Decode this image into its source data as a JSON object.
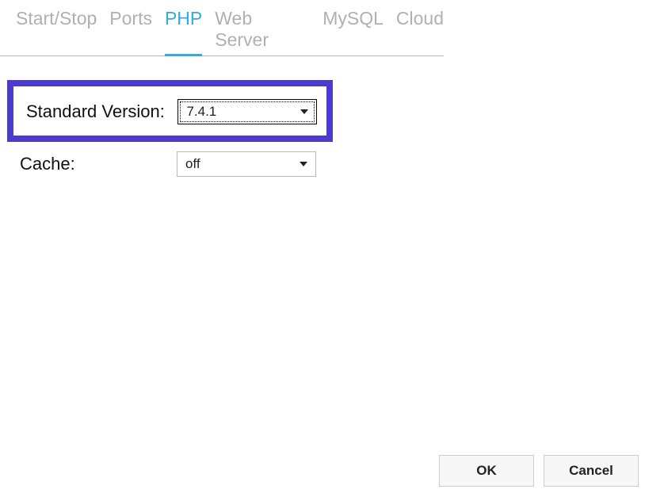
{
  "tabs": {
    "items": [
      {
        "label": "Start/Stop"
      },
      {
        "label": "Ports"
      },
      {
        "label": "PHP"
      },
      {
        "label": "Web Server"
      },
      {
        "label": "MySQL"
      },
      {
        "label": "Cloud"
      }
    ],
    "active_index": 2
  },
  "form": {
    "version_label": "Standard Version:",
    "version_value": "7.4.1",
    "cache_label": "Cache:",
    "cache_value": "off"
  },
  "buttons": {
    "ok": "OK",
    "cancel": "Cancel"
  }
}
